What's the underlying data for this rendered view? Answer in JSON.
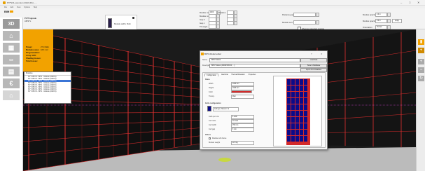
{
  "window": {
    "title": "PV*SOL premium 2022 (R1) - ...",
    "minimize": "–",
    "maximize": "□",
    "close": "✕"
  },
  "menu": [
    "File",
    "Edit",
    "View",
    "Options",
    "Help"
  ],
  "toolbar": {
    "brand": "BIM",
    "product_label": "PV/T bigrade",
    "product_sub": "AMSTL",
    "module_label": "Module width, Rdm",
    "fields_col1": [
      "Module row",
      "Module col",
      "Gap h",
      "Gap v",
      "Tilt angle",
      "Rotation"
    ],
    "fields_col1_values": [
      "1000",
      "",
      "",
      "",
      "",
      ""
    ],
    "field_col2_label": "Distance gap / m",
    "field_col3_label": "Module sort",
    "checkbox_label": "Show as selected module",
    "right_fields": [
      "Module spacing",
      "Module spacing",
      "Orientation"
    ],
    "right_values": [
      "0.0 m",
      "0.0 m",
      "Portrait"
    ],
    "apply_label": "Apply"
  },
  "sidebar": {
    "items": [
      "3D",
      "home-icon",
      "grid-icon",
      "inverter-icon",
      "results-icon",
      "euro-icon"
    ]
  },
  "info_panel": {
    "rows": [
      {
        "label": "Power:",
        "value": "27.0 kWp"
      },
      {
        "label": "Modules area:",
        "value": "105.1 m²"
      },
      {
        "label": "PV generation:",
        "value": ""
      },
      {
        "label": "Array shift:",
        "value": ""
      },
      {
        "label": "Shading losses:",
        "value": ""
      },
      {
        "label": "Total losses:",
        "value": ""
      }
    ]
  },
  "module_list": {
    "header": "Modules",
    "items": [
      "PVT 250 W - BHC - Module (AWCS)",
      "PVT 250 W - BHC - Module (AWCS)",
      "PVT 250 W - BHC - Module (AWCS)",
      "PVT 250 W - BHC - Module (AWCS)",
      "PVT 250 W - BHC - Module (AWCS)",
      "PVT 250 W - BHC - Module (AWCS)",
      "PVT 250 W - BHC - Module (AWCS)",
      "PVT 250 W - BHC - Module (AWCS)"
    ],
    "selected_index": 2
  },
  "dialog": {
    "title": "BIPV-Modul editor",
    "help": "?",
    "close": "✕",
    "name_label": "Name:",
    "name_value": "BIPV Modul",
    "name_button": "Load Data",
    "desc_label": "Description:",
    "desc_value": "BIPV Modul (150W/250 W, ...)",
    "desc_button": "Save to Database",
    "extra_button": "Import from Database",
    "tabs": [
      "Configuration",
      "Electrical",
      "Thermal Behaviour",
      "Properties"
    ],
    "section_glass": "Glass",
    "glass_fields": [
      {
        "label": "Width",
        "value": "1000 mm"
      },
      {
        "label": "Height",
        "value": "1600 mm"
      },
      {
        "label": "Color",
        "value": ""
      },
      {
        "label": "Transp.",
        "value": "Matt"
      }
    ],
    "section_cells": "Cells configuration",
    "cell_type": "Cell type: Monocr. Si",
    "cell_fields": [
      {
        "label": "Cells per row",
        "value": "6 cells"
      },
      {
        "label": "Cell rows",
        "value": "10 rows"
      },
      {
        "label": "Cell width",
        "value": "156 mm"
      },
      {
        "label": "Cell gap",
        "value": "3 mm"
      }
    ],
    "section_other": "Others",
    "other_checkbox": "Module with frame",
    "other_field": {
      "label": "Module weight",
      "value": "22.0 kg"
    }
  },
  "colors": {
    "accent": "#f2a200",
    "grid": "#d42a2a",
    "dialog_cell": "#0b0b8a",
    "selection": "#3b75d6",
    "ground": "#bbbbbb"
  }
}
